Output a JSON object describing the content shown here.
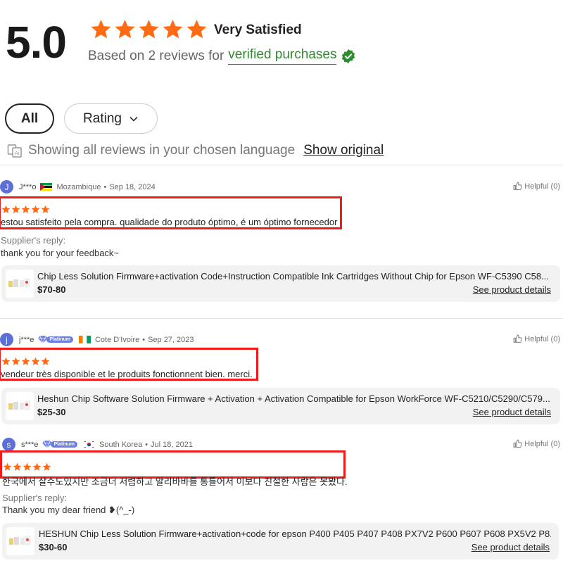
{
  "summary": {
    "score": "5.0",
    "satisfaction": "Very Satisfied",
    "based_on": "Based on 2 reviews for",
    "verified": "verified purchases",
    "stars_filled": 5,
    "star_color": "#ff6a13",
    "verified_color": "#2e8b2e"
  },
  "filters": {
    "all": "All",
    "rating": "Rating"
  },
  "language": {
    "notice": "Showing all reviews in your chosen language",
    "show_original": "Show original"
  },
  "reviews": [
    {
      "initial": "J",
      "user": "J***o",
      "country": "Mozambique",
      "date": "Sep 18, 2024",
      "helpful": "Helpful (0)",
      "rating": 5,
      "text": "estou satisfeito pela compra. qualidade do produto óptimo, é um óptimo fornecedor",
      "reply_label": "Supplier's reply:",
      "reply": "thank you for your feedback~",
      "product": {
        "name": "Chip Less Solution Firmware+activation Code+Instruction Compatible Ink Cartridges Without Chip for Epson WF-C5390 C58...",
        "price": "$70-80",
        "details": "See product details"
      }
    },
    {
      "initial": "j",
      "user": "j***e",
      "badge": "Platinum",
      "country": "Cote D'Ivoire",
      "date": "Sep 27, 2023",
      "helpful": "Helpful (0)",
      "rating": 5,
      "text": "vendeur très disponible et le produits fonctionnent bien. merci.",
      "product": {
        "name": "Heshun Chip Software Solution Firmware + Activation + Activation Compatible for Epson WorkForce WF-C5210/C5290/C579...",
        "price": "$25-30",
        "details": "See product details"
      }
    },
    {
      "initial": "s",
      "user": "s***e",
      "badge": "Platinum",
      "country": "South Korea",
      "date": "Jul 18, 2021",
      "helpful": "Helpful (0)",
      "rating": 5,
      "text": "한국에서 살수도있지만 조금더 저렴하고 알리바바를 통틀어서 이보다 친절한 사람은 못봤다.",
      "reply_label": "Supplier's reply:",
      "reply": "Thank you my dear friend ❥(^_-)",
      "product": {
        "name": "HESHUN Chip Less Solution Firmware+activation+code for epson P400 P405 P407 P408 PX7V2 P600 P607 P608 PX5V2 P8...",
        "price": "$30-60",
        "details": "See product details"
      }
    }
  ],
  "icons": {
    "star": "star-icon",
    "verified": "verified-check-icon",
    "chevron": "chevron-down-icon",
    "language": "translate-icon",
    "helpful": "thumbs-up-icon"
  },
  "colors": {
    "highlight_box": "#ee1c1c",
    "avatar": "#5b6fd6",
    "product_bg": "#f2f2f2"
  }
}
